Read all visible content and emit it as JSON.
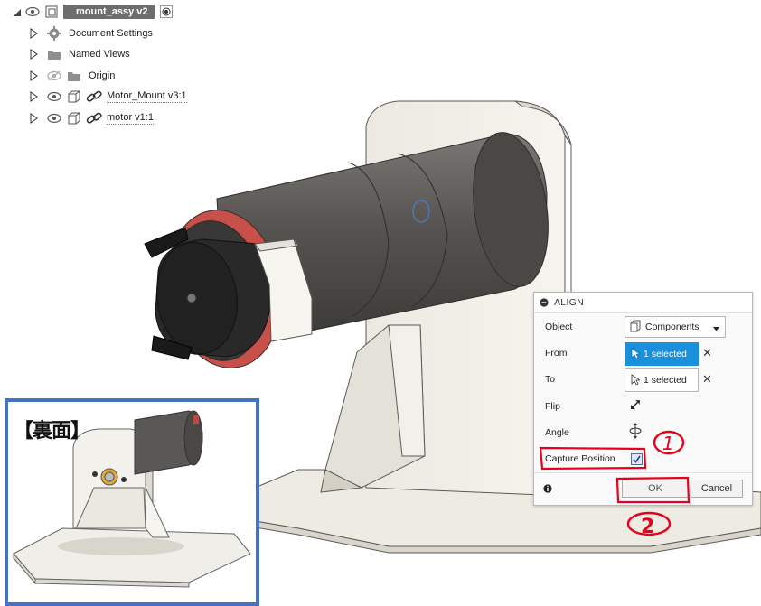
{
  "tree": {
    "root_label": "mount_assy v2",
    "items": [
      {
        "label": "Document Settings",
        "icon": "gear-icon"
      },
      {
        "label": "Named Views",
        "icon": "folder-icon"
      },
      {
        "label": "Origin",
        "icon": "folder-icon",
        "hidden": true
      },
      {
        "label": "Motor_Mount v3:1",
        "icon": "component-icon",
        "linked": true
      },
      {
        "label": "motor v1:1",
        "icon": "component-icon",
        "linked": true
      }
    ]
  },
  "inset": {
    "label": "【裏面】",
    "border_color": "#4472c4"
  },
  "align": {
    "title": "ALIGN",
    "object_label": "Object",
    "object_value": "Components",
    "from_label": "From",
    "from_value": "1 selected",
    "to_label": "To",
    "to_value": "1 selected",
    "flip_label": "Flip",
    "angle_label": "Angle",
    "capture_label": "Capture Position",
    "capture_checked": true,
    "ok_label": "OK",
    "cancel_label": "Cancel"
  },
  "annotations": {
    "step1": "1",
    "step2": "2",
    "color": "#e8001c"
  },
  "colors": {
    "selected_blue": "#1a8fdc",
    "motor_body": "#5c5a58",
    "mount": "#efece4",
    "red_ring": "#c8504a"
  }
}
